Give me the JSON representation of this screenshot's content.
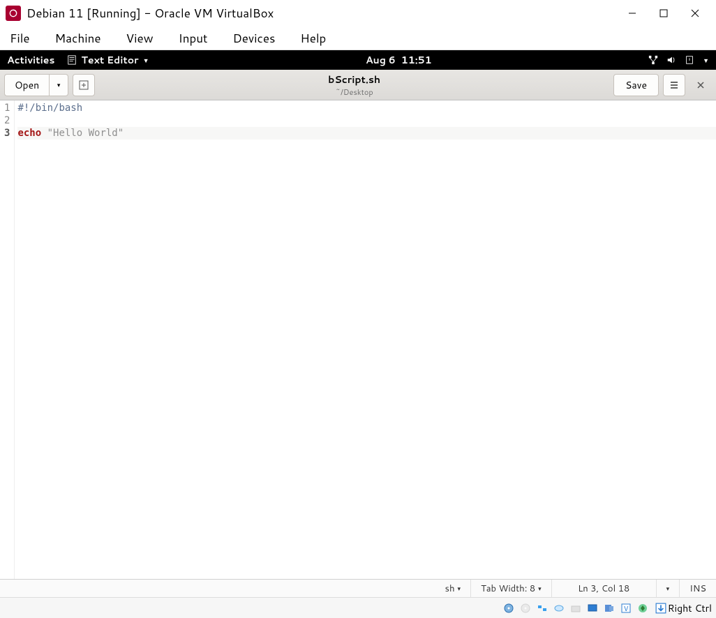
{
  "vbox": {
    "title": "Debian 11 [Running] - Oracle VM VirtualBox",
    "menus": [
      "File",
      "Machine",
      "View",
      "Input",
      "Devices",
      "Help"
    ],
    "host_key": "Right Ctrl"
  },
  "gnome": {
    "activities": "Activities",
    "app_name": "Text Editor",
    "date": "Aug 6",
    "time": "11:51"
  },
  "gedit": {
    "open_label": "Open",
    "save_label": "Save",
    "filename": "bScript.sh",
    "path": "~/Desktop",
    "lines": [
      {
        "n": "1",
        "tokens": [
          {
            "t": "#!/bin/bash",
            "cls": "tok-path"
          }
        ]
      },
      {
        "n": "2",
        "tokens": []
      },
      {
        "n": "3",
        "tokens": [
          {
            "t": "echo",
            "cls": "tok-kw"
          },
          {
            "t": " ",
            "cls": ""
          },
          {
            "t": "\"Hello World\"",
            "cls": "tok-str"
          }
        ],
        "current": true
      }
    ],
    "status": {
      "lang": "sh",
      "tab_width": "Tab Width: 8",
      "position": "Ln 3, Col 18",
      "insert_mode": "INS"
    }
  }
}
